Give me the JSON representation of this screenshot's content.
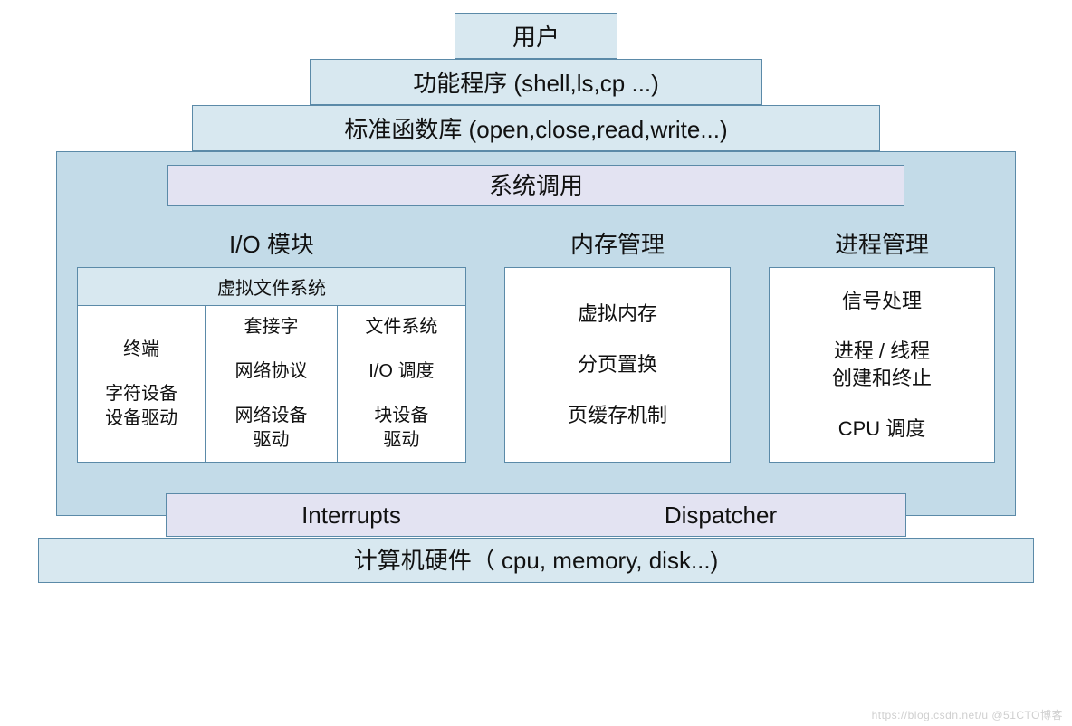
{
  "layers": {
    "user": "用户",
    "shell": "功能程序 (shell,ls,cp ...)",
    "stdlib": "标准函数库 (open,close,read,write...)"
  },
  "kernel": {
    "syscall": "系统调用",
    "io": {
      "title": "I/O 模块",
      "vfs": "虚拟文件系统",
      "c1a": "终端",
      "c1b": "字符设备\n设备驱动",
      "c2a": "套接字",
      "c2b": "网络协议",
      "c2c": "网络设备\n驱动",
      "c3a": "文件系统",
      "c3b": "I/O 调度",
      "c3c": "块设备\n驱动"
    },
    "mem": {
      "title": "内存管理",
      "a": "虚拟内存",
      "b": "分页置换",
      "c": "页缓存机制"
    },
    "proc": {
      "title": "进程管理",
      "a": "信号处理",
      "b": "进程 / 线程\n创建和终止",
      "c": "CPU 调度"
    },
    "interrupts": "Interrupts",
    "dispatcher": "Dispatcher"
  },
  "hardware": "计算机硬件（ cpu, memory, disk...)",
  "watermark": "https://blog.csdn.net/u   @51CTO博客"
}
